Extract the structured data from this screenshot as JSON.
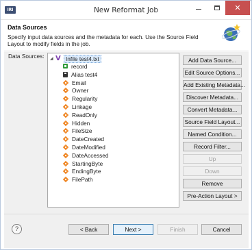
{
  "window": {
    "title": "New Reformat Job",
    "app_icon_text": "IRI",
    "icons": {
      "minimize": "minimize-icon",
      "maximize": "maximize-icon",
      "close": "close-icon"
    }
  },
  "header": {
    "title": "Data Sources",
    "description": "Specify input data sources and the metadata for each. Use the Source Field Layout to modify fields in the job.",
    "icon": "wizard-globe-icon"
  },
  "data_sources": {
    "label": "Data Sources:",
    "root": {
      "label": "Infile test4.txt",
      "icon": "source-v-icon",
      "expanded": true
    },
    "items": [
      {
        "label": "record",
        "icon": "record-icon"
      },
      {
        "label": "Alias test4",
        "icon": "alias-icon"
      },
      {
        "label": "Email",
        "icon": "field-icon"
      },
      {
        "label": "Owner",
        "icon": "field-icon"
      },
      {
        "label": "Regularity",
        "icon": "field-icon"
      },
      {
        "label": "Linkage",
        "icon": "field-icon"
      },
      {
        "label": "ReadOnly",
        "icon": "field-icon"
      },
      {
        "label": "Hidden",
        "icon": "field-icon"
      },
      {
        "label": "FileSize",
        "icon": "field-icon"
      },
      {
        "label": "DateCreated",
        "icon": "field-icon"
      },
      {
        "label": "DateModified",
        "icon": "field-icon"
      },
      {
        "label": "DateAccessed",
        "icon": "field-icon"
      },
      {
        "label": "StartingByte",
        "icon": "field-icon"
      },
      {
        "label": "EndingByte",
        "icon": "field-icon"
      },
      {
        "label": "FilePath",
        "icon": "field-icon"
      }
    ]
  },
  "side_buttons": [
    {
      "label": "Add Data Source...",
      "enabled": true
    },
    {
      "label": "Edit Source Options...",
      "enabled": true
    },
    {
      "label": "Add Existing Metadata...",
      "enabled": true
    },
    {
      "label": "Discover Metadata...",
      "enabled": true
    },
    {
      "label": "Convert Metadata...",
      "enabled": true
    },
    {
      "label": "Source Field Layout...",
      "enabled": true
    },
    {
      "label": "Named Condition...",
      "enabled": true
    },
    {
      "label": "Record Filter...",
      "enabled": true
    },
    {
      "label": "Up",
      "enabled": false
    },
    {
      "label": "Down",
      "enabled": false
    },
    {
      "label": "Remove",
      "enabled": true
    },
    {
      "label": "Pre-Action Layout >",
      "enabled": true
    }
  ],
  "footer": {
    "help": "?",
    "back": "< Back",
    "next": "Next >",
    "finish": "Finish",
    "cancel": "Cancel"
  }
}
